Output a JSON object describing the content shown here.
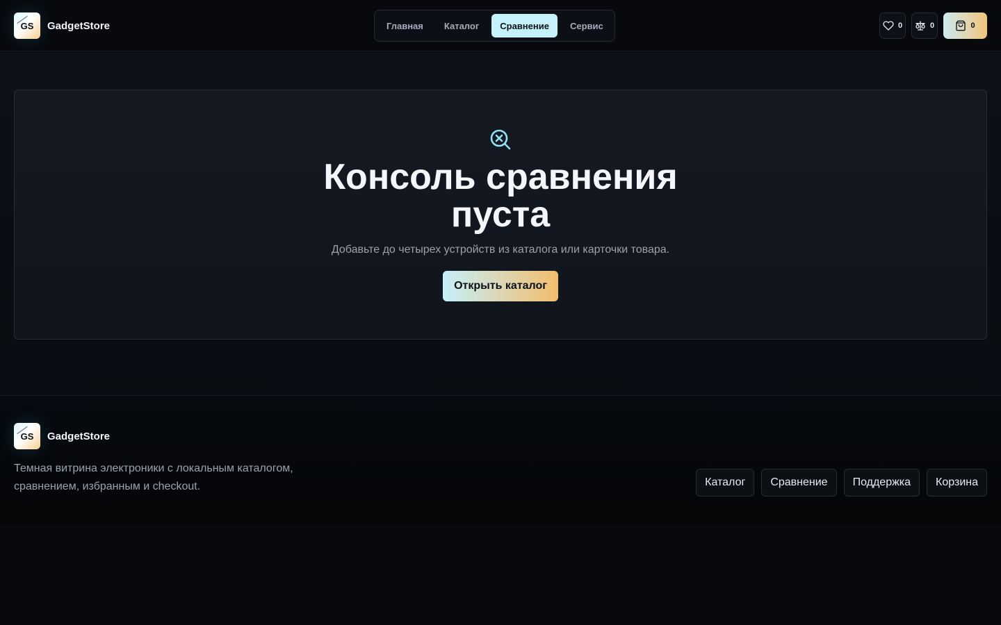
{
  "brand": {
    "logo_text": "GS",
    "name": "GadgetStore"
  },
  "nav": {
    "items": [
      {
        "label": "Главная"
      },
      {
        "label": "Каталог"
      },
      {
        "label": "Сравнение",
        "active": true
      },
      {
        "label": "Сервис"
      }
    ]
  },
  "header_actions": {
    "favorites_count": "0",
    "compare_count": "0",
    "cart_count": "0",
    "icons": [
      "heart-icon",
      "scales-icon",
      "shopping-bag-icon"
    ]
  },
  "empty_state": {
    "icon": "search-x-icon",
    "title": "Консоль сравнения пуста",
    "subtitle": "Добавьте до четырех устройств из каталога или карточки товара.",
    "button_label": "Открыть каталог"
  },
  "footer": {
    "logo_text": "GS",
    "name": "GadgetStore",
    "description": "Темная витрина электроники с локальным каталогом, сравнением, избранным и checkout.",
    "links": [
      {
        "label": "Каталог"
      },
      {
        "label": "Сравнение"
      },
      {
        "label": "Поддержка"
      },
      {
        "label": "Корзина"
      }
    ]
  },
  "colors": {
    "background": "#06080c",
    "accent_cyan": "#c5f1fb",
    "accent_gold": "#f2bd6d",
    "icon_cyan": "#8fe3f5"
  }
}
